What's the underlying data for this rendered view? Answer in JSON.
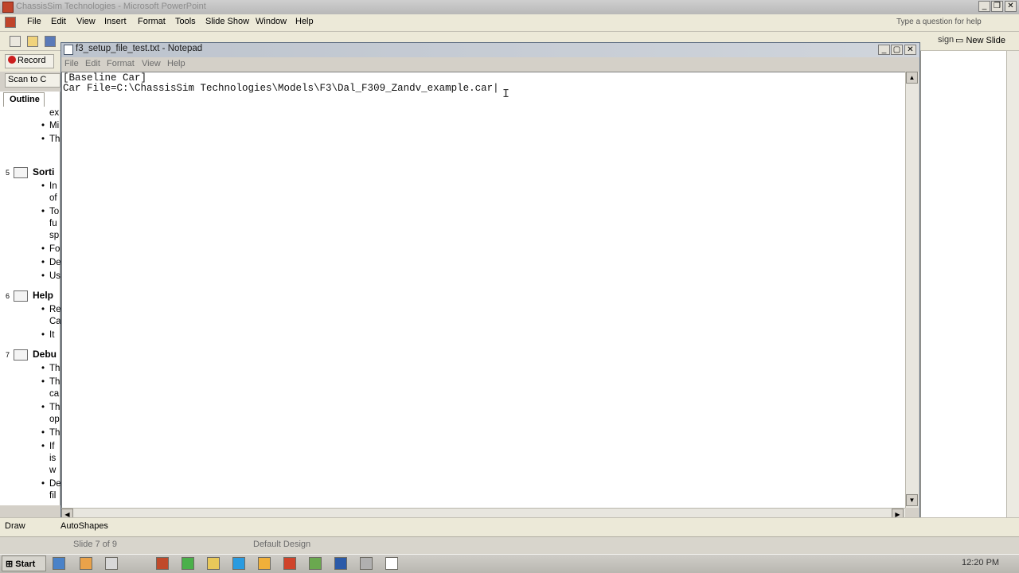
{
  "powerpoint": {
    "title": "ChassisSim Technologies - Microsoft PowerPoint",
    "menu": [
      "File",
      "Edit",
      "View",
      "Insert",
      "Format",
      "Tools",
      "Slide Show",
      "Window",
      "Help"
    ],
    "help_placeholder": "Type a question for help",
    "toolbar": {
      "record_label": "Record",
      "scan_label": "Scan to C",
      "design_label": "sign",
      "new_slide_label": "New Slide"
    },
    "outline": {
      "tab_label": "Outline",
      "lines": [
        {
          "text": "ex",
          "kind": "cont"
        },
        {
          "text": "Mi",
          "kind": "bullet"
        },
        {
          "text": "Th",
          "kind": "bullet"
        },
        {
          "num": "5",
          "text": "Sorti",
          "kind": "head"
        },
        {
          "text": "In",
          "kind": "bullet"
        },
        {
          "text": "of",
          "kind": "cont"
        },
        {
          "text": "To",
          "kind": "bullet"
        },
        {
          "text": "fu",
          "kind": "cont"
        },
        {
          "text": "sp",
          "kind": "cont"
        },
        {
          "text": "Fo",
          "kind": "bullet"
        },
        {
          "text": "De",
          "kind": "bullet"
        },
        {
          "text": "Us",
          "kind": "bullet"
        },
        {
          "num": "6",
          "text": "Help",
          "kind": "head"
        },
        {
          "text": "Re",
          "kind": "bullet"
        },
        {
          "text": "Ca",
          "kind": "cont"
        },
        {
          "text": "It",
          "kind": "bullet"
        },
        {
          "num": "7",
          "text": "Debu",
          "kind": "head"
        },
        {
          "text": "Th",
          "kind": "bullet"
        },
        {
          "text": "Th",
          "kind": "bullet"
        },
        {
          "text": "ca",
          "kind": "cont"
        },
        {
          "text": "Th",
          "kind": "bullet"
        },
        {
          "text": "op",
          "kind": "cont"
        },
        {
          "text": "Th",
          "kind": "bullet"
        },
        {
          "text": "If",
          "kind": "bullet"
        },
        {
          "text": "is",
          "kind": "cont"
        },
        {
          "text": "w",
          "kind": "cont"
        },
        {
          "text": "De",
          "kind": "bullet"
        },
        {
          "text": "fil",
          "kind": "cont"
        }
      ]
    },
    "draw_toolbar": {
      "draw_label": "Draw",
      "autoshapes_label": "AutoShapes"
    },
    "status": {
      "slide": "Slide 7 of 9",
      "design": "Default Design"
    }
  },
  "notepad": {
    "title": "f3_setup_file_test.txt - Notepad",
    "menu": [
      "File",
      "Edit",
      "Format",
      "View",
      "Help"
    ],
    "content": "[Baseline Car]\nCar File=C:\\ChassisSim Technologies\\Models\\F3\\Dal_F309_Zandv_example.car|"
  },
  "taskbar": {
    "start_label": "Start",
    "clock": "12:20 PM"
  },
  "colors": {
    "record_red": "#cc1f1f",
    "notepad_title_bg": "#c6ccd4",
    "desktop_gray": "#d4d0c8"
  }
}
